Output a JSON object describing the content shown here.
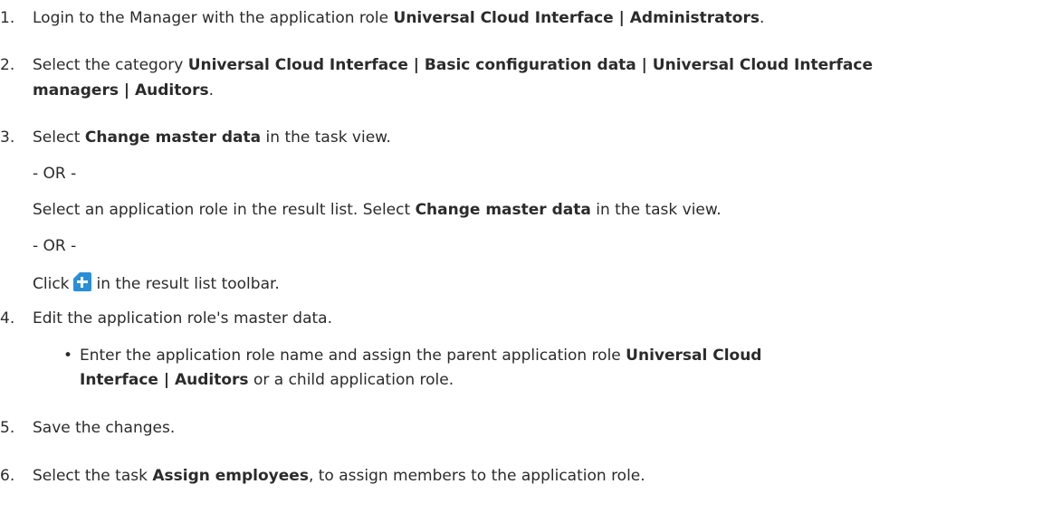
{
  "steps": {
    "s1": {
      "num": "1.",
      "text_a": "Login to the Manager with the application role ",
      "bold_a": "Universal Cloud Interface | Administrators",
      "text_b": "."
    },
    "s2": {
      "num": "2.",
      "text_a": "Select the category ",
      "bold_a": "Universal Cloud Interface | Basic configuration data | Universal Cloud Interface",
      "bold_b": "managers | Auditors",
      "text_b": "."
    },
    "s3": {
      "num": "3.",
      "text_a": "Select ",
      "bold_a": "Change master data",
      "text_b": " in the task view."
    },
    "or1": "- OR -",
    "s3b": {
      "text_a": "Select an application role in the result list. Select ",
      "bold_a": "Change master data",
      "text_b": " in the task view."
    },
    "or2": "- OR -",
    "s3c": {
      "text_a": "Click",
      "text_b": "in the result list toolbar.",
      "icon": "add-new-icon"
    },
    "s4": {
      "num": "4.",
      "text_a": "Edit the application role's master data."
    },
    "s4b": {
      "bullet": "•",
      "text_a": "Enter the application role name and assign the parent application role ",
      "bold_a": "Universal Cloud",
      "bold_b": "Interface | Auditors",
      "text_b": " or a child application role."
    },
    "s5": {
      "num": "5.",
      "text_a": "Save the changes."
    },
    "s6": {
      "num": "6.",
      "text_a": "Select the task ",
      "bold_a": "Assign employees",
      "text_b": ", to assign members to the application role."
    }
  }
}
